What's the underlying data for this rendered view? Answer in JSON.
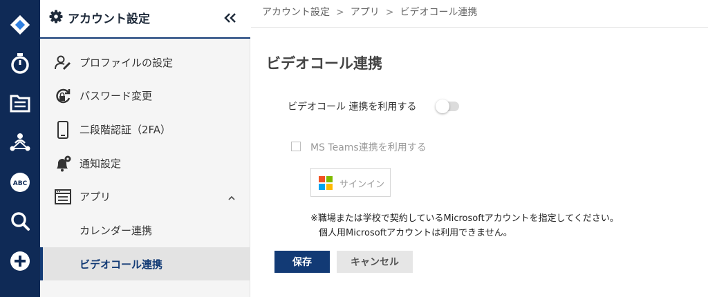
{
  "rail": {
    "bg_color": "#0f2a56",
    "items": [
      {
        "name": "logo-diamond-icon"
      },
      {
        "name": "stopwatch-icon"
      },
      {
        "name": "document-list-icon"
      },
      {
        "name": "people-network-icon"
      },
      {
        "name": "abc-badge-icon",
        "text": "ABC"
      },
      {
        "name": "search-icon"
      },
      {
        "name": "add-circle-icon"
      }
    ]
  },
  "sidebar": {
    "title": "アカウント設定",
    "items": [
      {
        "label": "プロファイルの設定",
        "icon": "profile-edit-icon"
      },
      {
        "label": "パスワード変更",
        "icon": "password-lock-icon"
      },
      {
        "label": "二段階認証（2FA）",
        "icon": "phone-icon"
      },
      {
        "label": "通知設定",
        "icon": "bell-gear-icon"
      },
      {
        "label": "アプリ",
        "icon": "app-window-icon",
        "expanded": true
      },
      {
        "label": "カレンダー連携"
      },
      {
        "label": "ビデオコール連携",
        "active": true
      }
    ]
  },
  "breadcrumb": {
    "items": [
      "アカウント設定",
      "アプリ",
      "ビデオコール連携"
    ],
    "separator": ">"
  },
  "main": {
    "title": "ビデオコール連携",
    "toggle_label": "ビデオコール 連携を利用する",
    "toggle_on": false,
    "teams_label": "MS Teams連携を利用する",
    "teams_checked": false,
    "signin_label": "サインイン",
    "note_line1": "※職場または学校で契約しているMicrosoftアカウントを指定してください。",
    "note_line2": "個人用Microsoftアカウントは利用できません。",
    "save_label": "保存",
    "cancel_label": "キャンセル"
  },
  "colors": {
    "primary": "#123a75",
    "ms_red": "#f25022",
    "ms_green": "#7fba00",
    "ms_blue": "#00a4ef",
    "ms_yellow": "#ffb900"
  }
}
